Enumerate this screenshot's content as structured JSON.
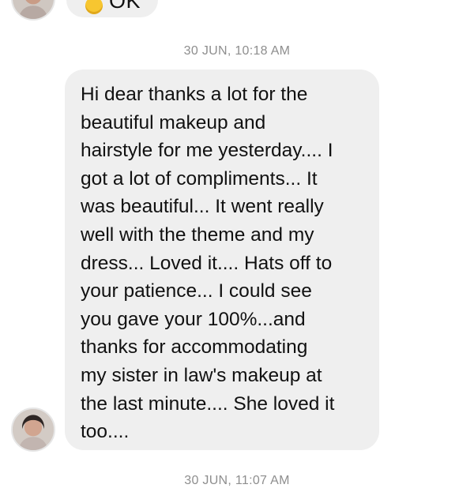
{
  "conversation": {
    "previous_message": {
      "emoji": "thumbs-up-emoji",
      "text": "OK"
    },
    "timestamps": [
      "30 JUN, 10:18 AM",
      "30 JUN, 11:07 AM"
    ],
    "message": {
      "lines": [
        "Hi dear thanks a lot for the",
        "beautiful makeup and",
        "hairstyle for me yesterday.... I",
        "got a lot of compliments... It",
        "was beautiful... It went really",
        "well with the theme and my",
        "dress... Loved it.... Hats off to",
        "your patience... I could see",
        "you gave your 100%...and",
        "thanks for accommodating",
        "my sister in law's makeup at",
        "the last minute.... She loved it",
        "too...."
      ]
    }
  },
  "colors": {
    "bubble_background": "#efefef",
    "timestamp_text": "#8e8e8e",
    "message_text": "#111111"
  }
}
